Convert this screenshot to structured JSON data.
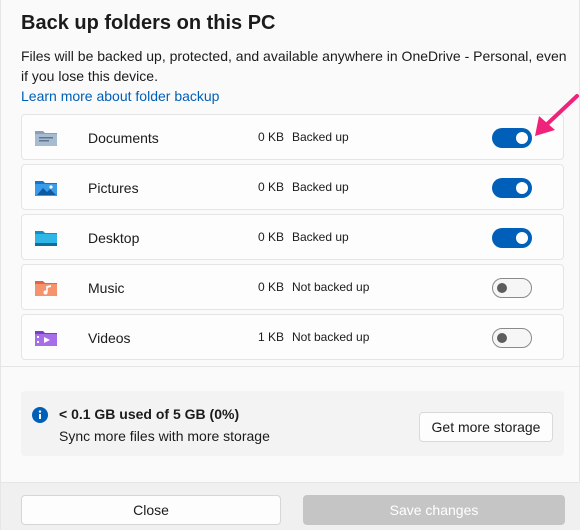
{
  "dialog": {
    "title": "Back up folders on this PC",
    "description": "Files will be backed up, protected, and available anywhere in OneDrive - Personal, even if you lose this device.",
    "learn_more": "Learn more about folder backup"
  },
  "folders": [
    {
      "name": "Documents",
      "size": "0 KB",
      "status": "Backed up",
      "backup_on": true,
      "icon": "documents-folder-icon"
    },
    {
      "name": "Pictures",
      "size": "0 KB",
      "status": "Backed up",
      "backup_on": true,
      "icon": "pictures-folder-icon"
    },
    {
      "name": "Desktop",
      "size": "0 KB",
      "status": "Backed up",
      "backup_on": true,
      "icon": "desktop-folder-icon"
    },
    {
      "name": "Music",
      "size": "0 KB",
      "status": "Not backed up",
      "backup_on": false,
      "icon": "music-folder-icon"
    },
    {
      "name": "Videos",
      "size": "1 KB",
      "status": "Not backed up",
      "backup_on": false,
      "icon": "videos-folder-icon"
    }
  ],
  "storage": {
    "usage": "< 0.1 GB used of 5 GB (0%)",
    "subtitle": "Sync more files with more storage",
    "button": "Get more storage",
    "icon": "info-icon"
  },
  "footer": {
    "close": "Close",
    "save": "Save changes"
  },
  "colors": {
    "accent": "#005fb8",
    "annotation_arrow": "#f0237a",
    "disabled_button": "#c5c5c5"
  }
}
